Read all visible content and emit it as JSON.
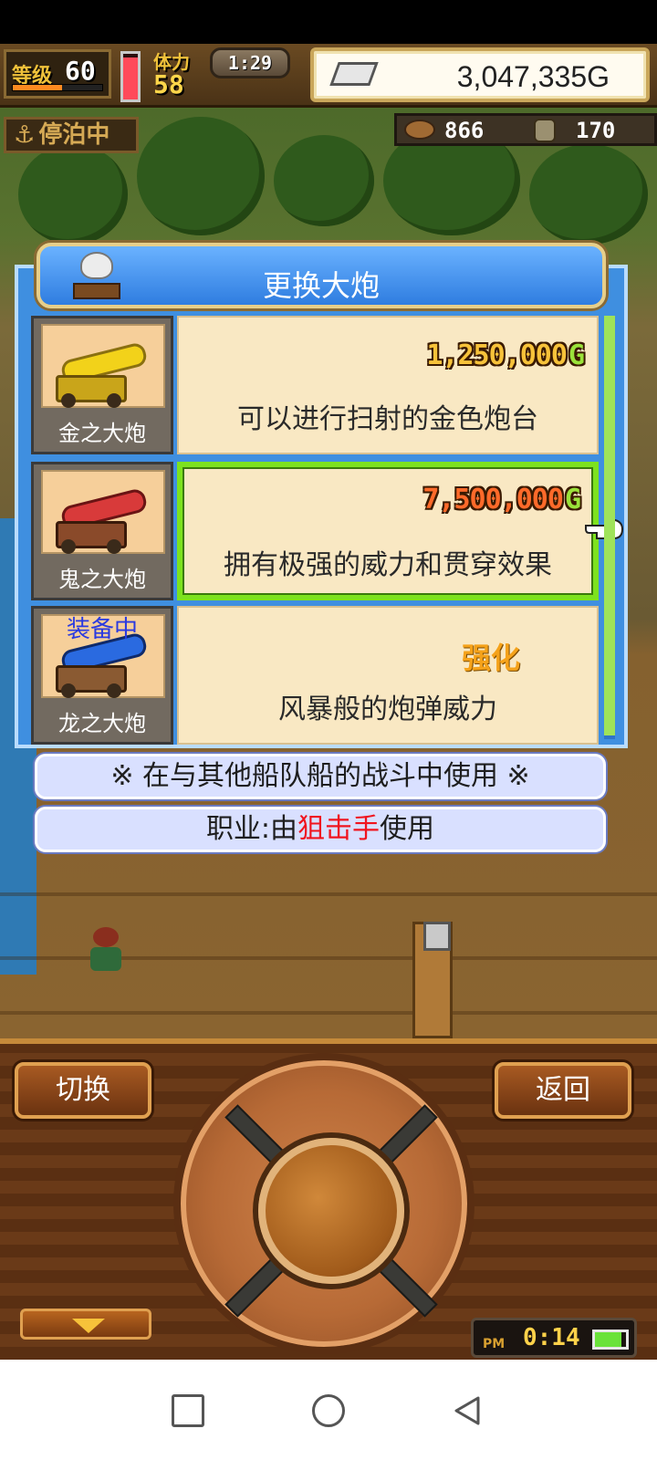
{
  "hud": {
    "level_label": "等级",
    "level": "60",
    "level_progress": 0.55,
    "stamina_label": "体力",
    "stamina": "58",
    "stamina_fill": 0.92,
    "time": "1:29",
    "gold": "3,047,335G",
    "status": "停泊中",
    "resource1": "866",
    "resource2": "170"
  },
  "dialog": {
    "title": "更换大炮",
    "items": [
      {
        "name": "金之大炮",
        "price": "1,250,000",
        "price_unit": "G",
        "description": "可以进行扫射的金色炮台",
        "color": "#f2d21a",
        "selected": false,
        "equipped": false
      },
      {
        "name": "鬼之大炮",
        "price": "7,500,000",
        "price_unit": "G",
        "description": "拥有极强的威力和贯穿效果",
        "color": "#c02a2a",
        "selected": true,
        "equipped": false
      },
      {
        "name": "龙之大炮",
        "equipped_label": "装备中",
        "action": "强化",
        "description": "风暴般的炮弹威力",
        "color": "#2a6ae0",
        "selected": false,
        "equipped": true
      }
    ],
    "note": "※ 在与其他船队船的战斗中使用 ※",
    "job_prefix": "职业:由",
    "job_highlight": "狙击手",
    "job_suffix": "使用"
  },
  "controls": {
    "switch_label": "切换",
    "back_label": "返回",
    "clock_period": "PM",
    "clock_time": "0:14",
    "battery_level": 0.85
  },
  "icons": [
    "anchor-icon",
    "gold-bar-icon",
    "log-icon",
    "coin-icon",
    "hand-cursor-icon",
    "battery-icon",
    "triangle-down-icon"
  ],
  "colors": {
    "selected_border": "#7de21e",
    "dialog_blue": "#3f8fe0",
    "highlight_red": "#f0141e"
  }
}
